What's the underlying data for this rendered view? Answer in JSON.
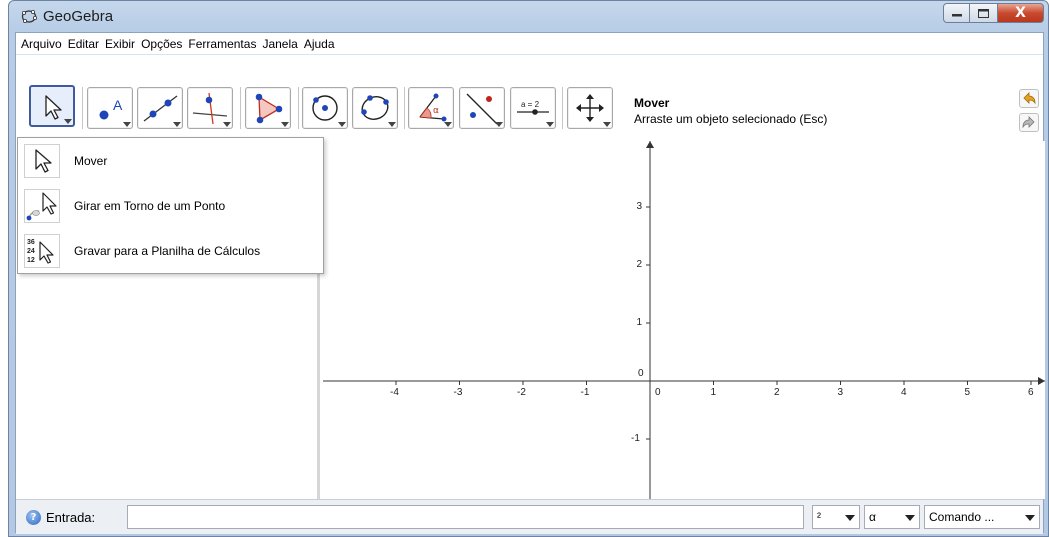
{
  "window": {
    "title": "GeoGebra",
    "controls": {
      "minimize": "minimize",
      "maximize": "maximize",
      "close": "X"
    }
  },
  "menu": [
    "Arquivo",
    "Editar",
    "Exibir",
    "Opções",
    "Ferramentas",
    "Janela",
    "Ajuda"
  ],
  "toolbar": {
    "tools": [
      {
        "name": "move",
        "icon": "move-arrow-icon",
        "active": true
      },
      {
        "name": "point",
        "icon": "new-point-icon",
        "active": false
      },
      {
        "name": "line",
        "icon": "line-through-two-points-icon",
        "active": false
      },
      {
        "name": "perpendicular",
        "icon": "perpendicular-line-icon",
        "active": false
      },
      {
        "name": "polygon",
        "icon": "polygon-icon",
        "active": false
      },
      {
        "name": "circle",
        "icon": "circle-center-point-icon",
        "active": false
      },
      {
        "name": "conic",
        "icon": "conic-through-points-icon",
        "active": false
      },
      {
        "name": "angle",
        "icon": "angle-icon",
        "active": false
      },
      {
        "name": "reflect",
        "icon": "reflect-about-line-icon",
        "active": false
      },
      {
        "name": "slider",
        "icon": "slider-icon",
        "active": false
      },
      {
        "name": "move-graphics",
        "icon": "move-graphics-view-icon",
        "active": false
      }
    ],
    "slider_text": "a = 2",
    "help_title": "Mover",
    "help_description": "Arraste um objeto selecionado (Esc)"
  },
  "dropdown": {
    "items": [
      {
        "label": "Mover",
        "icon": "move-arrow-icon"
      },
      {
        "label": "Girar em Torno de um Ponto",
        "icon": "rotate-around-point-icon"
      },
      {
        "label": "Gravar para a Planilha de Cálculos",
        "icon": "record-to-spreadsheet-icon"
      }
    ],
    "spreadsheet_icon_numbers": [
      "36",
      "24",
      "12"
    ]
  },
  "graphics": {
    "x_ticks": [
      "-4",
      "-3",
      "-2",
      "-1",
      "0",
      "1",
      "2",
      "3",
      "4",
      "5",
      "6"
    ],
    "y_ticks": [
      "3",
      "2",
      "1",
      "0",
      "-1"
    ]
  },
  "inputbar": {
    "label": "Entrada:",
    "value": "",
    "symbols_select": "²",
    "greek_select": "α",
    "command_select": "Comando ..."
  }
}
